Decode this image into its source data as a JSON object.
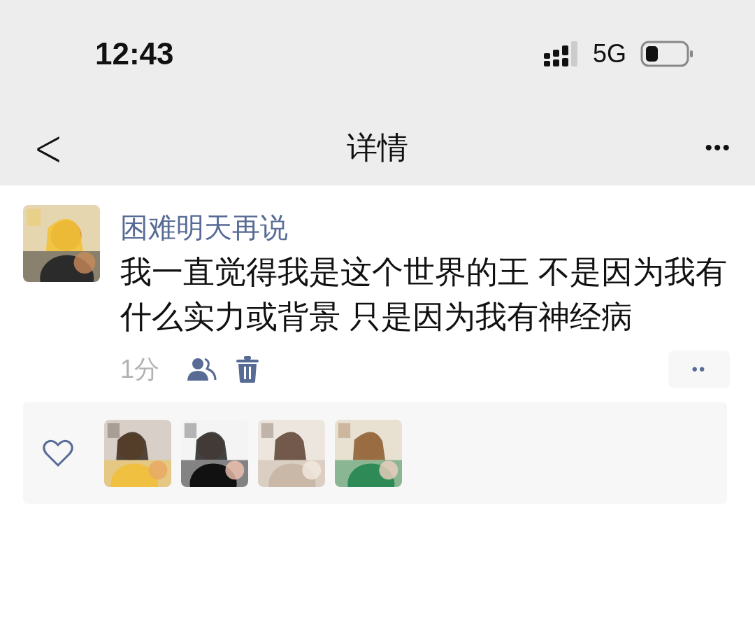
{
  "status_bar": {
    "time": "12:43",
    "network": "5G"
  },
  "nav_bar": {
    "back": "<",
    "title": "详情",
    "more": "•••"
  },
  "post": {
    "author": "困难明天再说",
    "text": "我一直觉得我是这个世界的王 不是因为我有什么实力或背景 只是因为我有神经病",
    "time": "1分",
    "more": "••"
  }
}
